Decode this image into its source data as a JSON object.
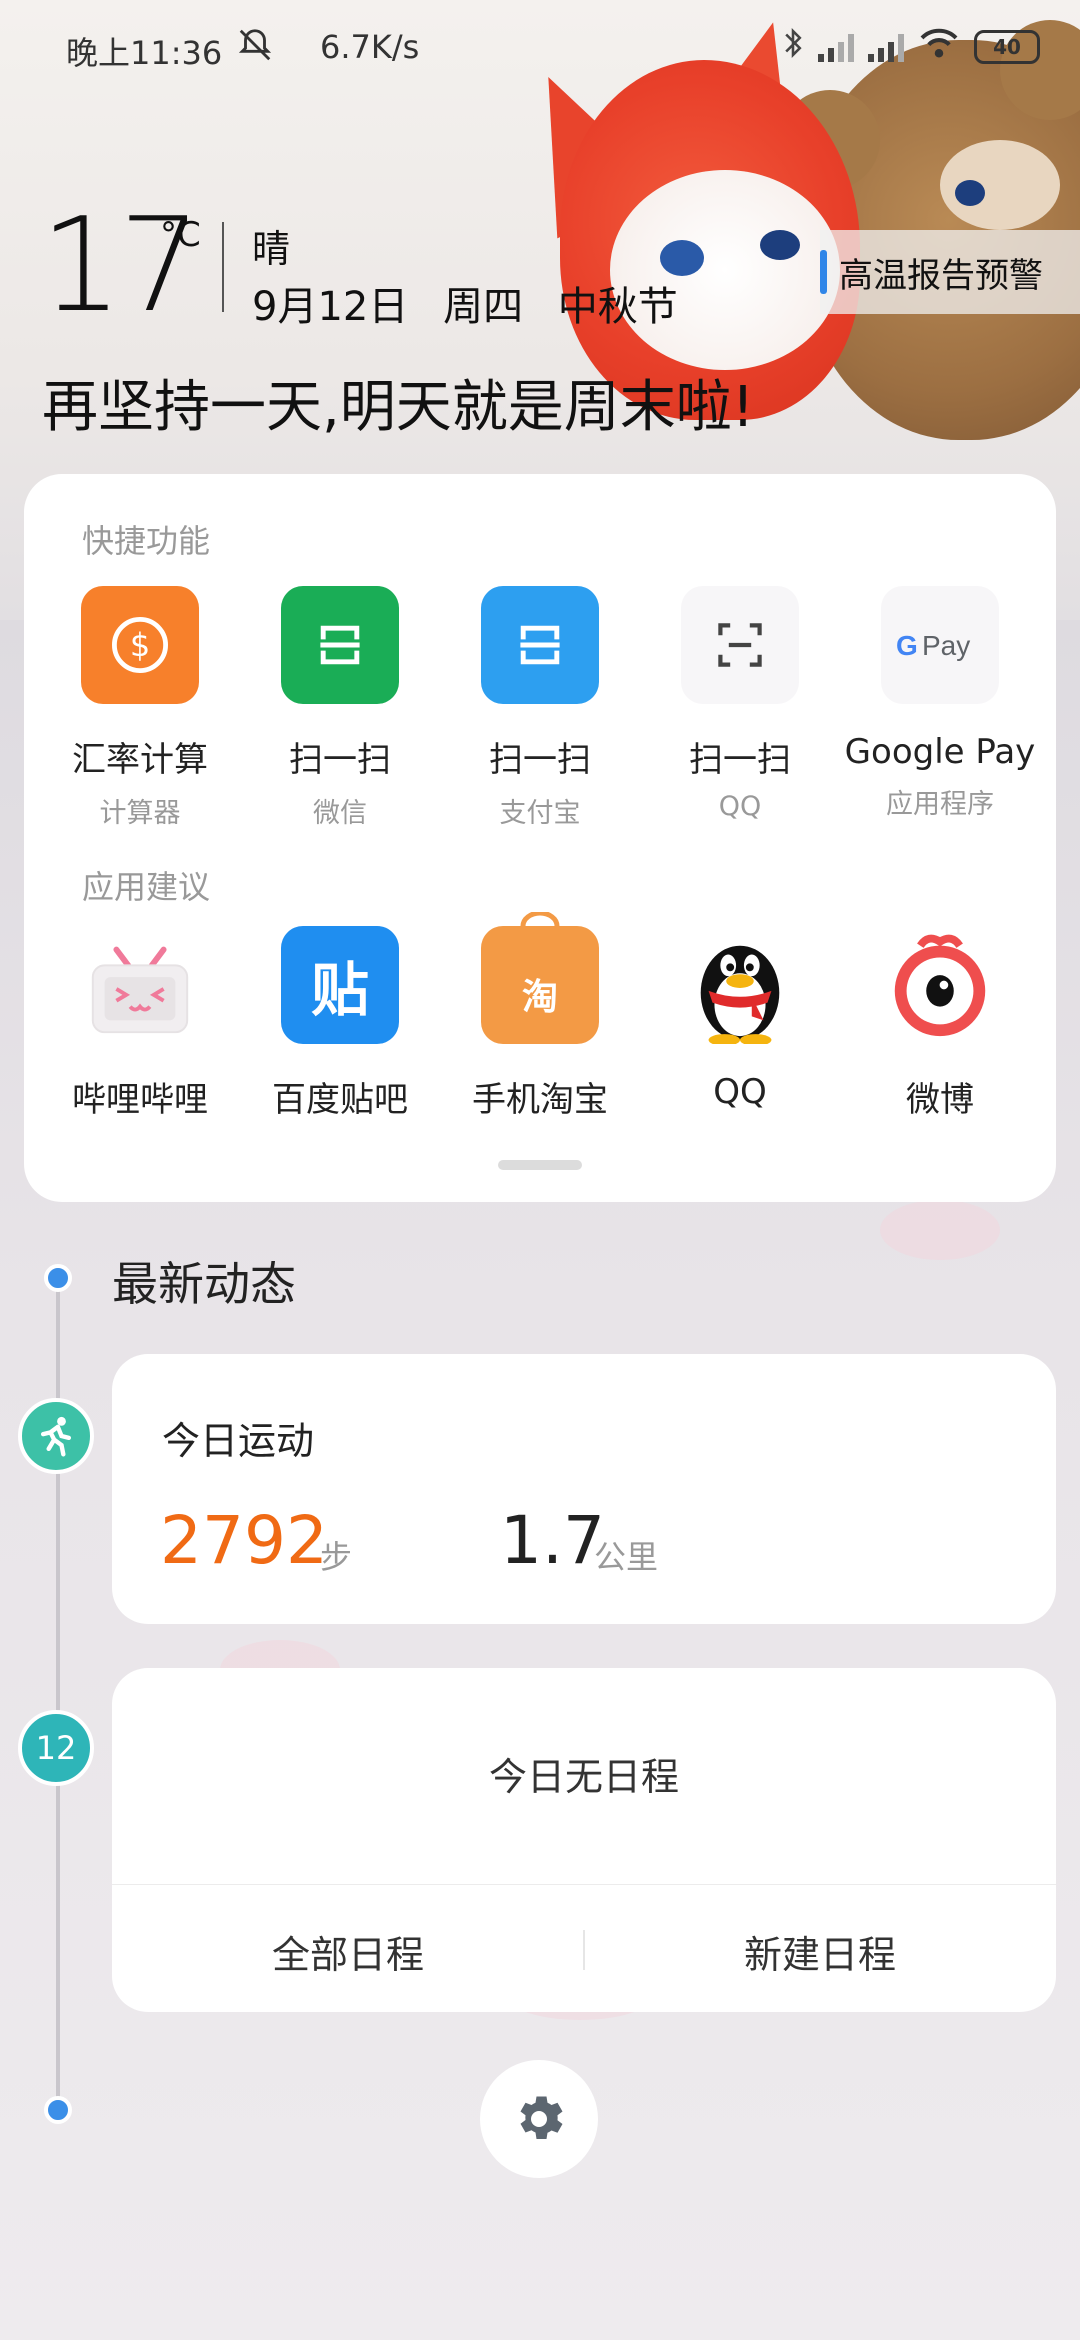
{
  "status_bar": {
    "time": "晚上11:36",
    "mute_icon": "bell-off-icon",
    "net_speed": "6.7K/s",
    "battery": "40"
  },
  "weather": {
    "temperature": "17",
    "unit": "°C",
    "condition": "晴",
    "date": "9月12日",
    "weekday": "周四",
    "festival": "中秋节",
    "alert": "高温报告预警"
  },
  "slogan": "再坚持一天,明天就是周末啦!",
  "quick_functions": {
    "title": "快捷功能",
    "items": [
      {
        "label": "汇率计算",
        "sub": "计算器",
        "icon": "currency-icon",
        "color": "#f7802b"
      },
      {
        "label": "扫一扫",
        "sub": "微信",
        "icon": "scan-icon",
        "color": "#1aad56"
      },
      {
        "label": "扫一扫",
        "sub": "支付宝",
        "icon": "scan-icon",
        "color": "#2d9ff0"
      },
      {
        "label": "扫一扫",
        "sub": "QQ",
        "icon": "scan-frame-icon",
        "color": "#f7f6f8"
      },
      {
        "label": "Google Pay",
        "sub": "应用程序",
        "icon": "google-pay-icon",
        "color": "#f7f6f8"
      }
    ]
  },
  "app_suggestions": {
    "title": "应用建议",
    "items": [
      {
        "label": "哔哩哔哩",
        "icon": "bilibili-icon"
      },
      {
        "label": "百度贴吧",
        "icon": "tieba-icon",
        "glyph": "贴"
      },
      {
        "label": "手机淘宝",
        "icon": "taobao-icon",
        "glyph": "淘"
      },
      {
        "label": "QQ",
        "icon": "qq-penguin-icon"
      },
      {
        "label": "微博",
        "icon": "weibo-icon"
      }
    ]
  },
  "feed": {
    "title": "最新动态",
    "sport": {
      "title": "今日运动",
      "steps": "2792",
      "steps_unit": "步",
      "distance": "1.7",
      "distance_unit": "公里"
    },
    "schedule": {
      "day_badge": "12",
      "empty_text": "今日无日程",
      "all_button": "全部日程",
      "new_button": "新建日程"
    }
  },
  "settings_icon": "gear-icon"
}
